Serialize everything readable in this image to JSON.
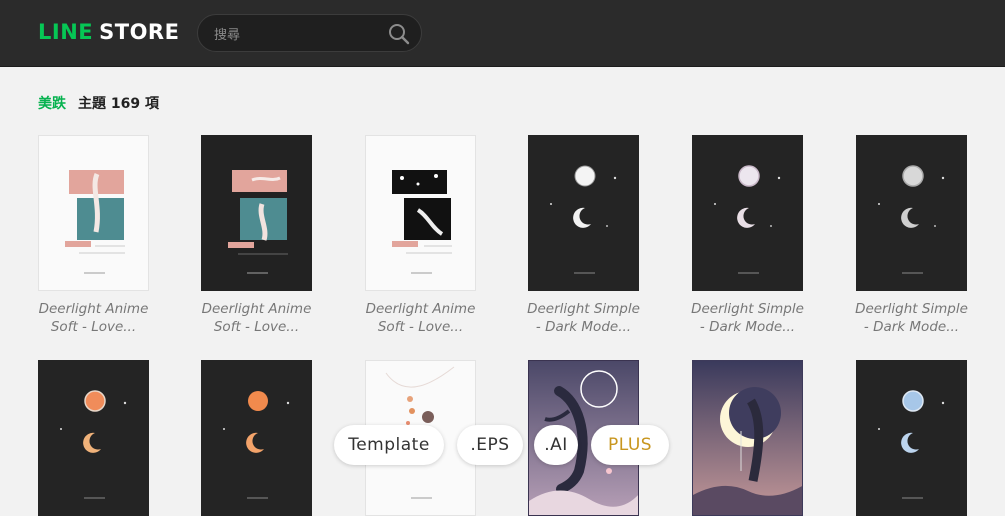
{
  "header": {
    "logo_line": "LINE",
    "logo_store": "STORE",
    "search_placeholder": "搜尋",
    "search_icon": "search-icon"
  },
  "section": {
    "category": "美跌",
    "count_label": "主題 169 項"
  },
  "themes": [
    {
      "title_line1": "Deerlight Anime",
      "title_line2": "Soft - Love...",
      "style": "light-pink"
    },
    {
      "title_line1": "Deerlight Anime",
      "title_line2": "Soft - Love...",
      "style": "dark-pink"
    },
    {
      "title_line1": "Deerlight Anime",
      "title_line2": "Soft - Love...",
      "style": "light-mono"
    },
    {
      "title_line1": "Deerlight Simple",
      "title_line2": "- Dark Mode...",
      "style": "dark-moon-white"
    },
    {
      "title_line1": "Deerlight Simple",
      "title_line2": "- Dark Mode...",
      "style": "dark-moon-pearl"
    },
    {
      "title_line1": "Deerlight Simple",
      "title_line2": "- Dark Mode...",
      "style": "dark-moon-silver"
    },
    {
      "style": "dark-moon-orange"
    },
    {
      "style": "dark-moon-coral"
    },
    {
      "style": "light-planets"
    },
    {
      "style": "purple-whale"
    },
    {
      "style": "dusk-moon-deer"
    },
    {
      "style": "dark-moon-blue"
    }
  ],
  "tags": [
    "Template",
    ".EPS",
    ".AI",
    "PLUS"
  ],
  "colors": {
    "brand_green": "#06c755",
    "category_green": "#06b24f",
    "plus_gold": "#c8961e",
    "header_bg": "#2b2b2b"
  }
}
